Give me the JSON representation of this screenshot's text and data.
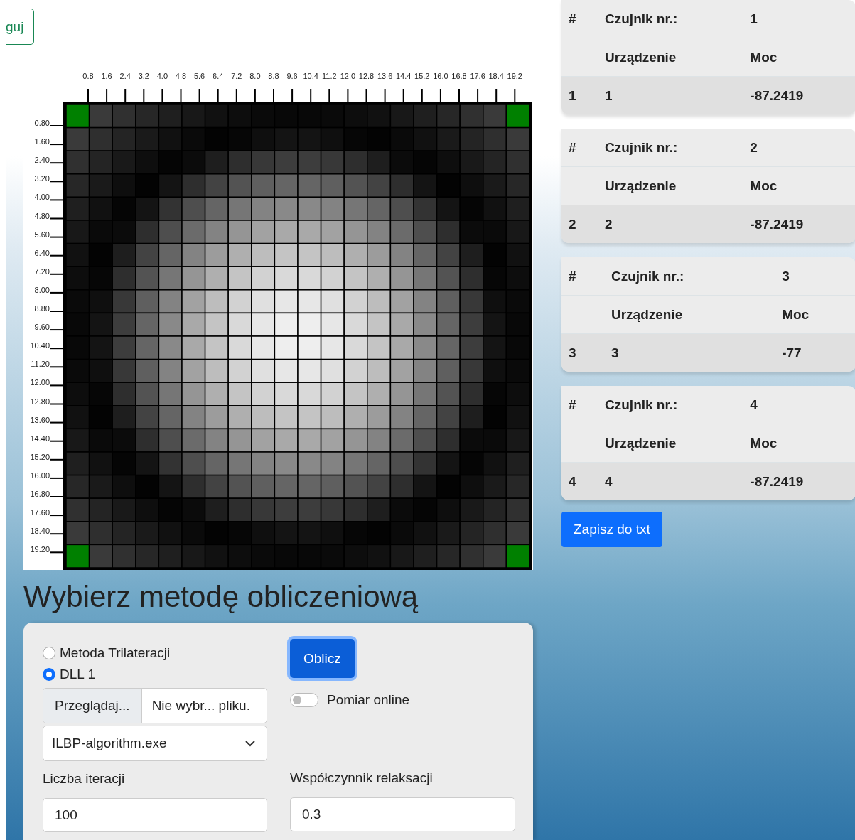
{
  "top_button": {
    "label": "guj"
  },
  "heatmap": {
    "x_ticks": [
      "0.8",
      "1.6",
      "2.4",
      "3.2",
      "4.0",
      "4.8",
      "5.6",
      "6.4",
      "7.2",
      "8.0",
      "8.8",
      "9.6",
      "10.4",
      "11.2",
      "12.0",
      "12.8",
      "13.6",
      "14.4",
      "15.2",
      "16.0",
      "16.8",
      "17.6",
      "18.4",
      "19.2"
    ],
    "y_ticks": [
      "0.80",
      "1.60",
      "2.40",
      "3.20",
      "4.00",
      "4.80",
      "5.60",
      "6.40",
      "7.20",
      "8.00",
      "8.80",
      "9.60",
      "10.40",
      "11.20",
      "12.00",
      "12.80",
      "13.60",
      "14.40",
      "15.20",
      "16.00",
      "16.80",
      "17.60",
      "18.40",
      "19.20"
    ]
  },
  "sensors": [
    {
      "hash": "#",
      "sensor_label": "Czujnik nr.:",
      "sensor_number": "1",
      "device_label": "Urządzenie",
      "power_label": "Moc",
      "index": "1",
      "device": "1",
      "power": "-87.2419"
    },
    {
      "hash": "#",
      "sensor_label": "Czujnik nr.:",
      "sensor_number": "2",
      "device_label": "Urządzenie",
      "power_label": "Moc",
      "index": "2",
      "device": "2",
      "power": "-87.2419"
    },
    {
      "hash": "#",
      "sensor_label": "Czujnik nr.:",
      "sensor_number": "3",
      "device_label": "Urządzenie",
      "power_label": "Moc",
      "index": "3",
      "device": "3",
      "power": "-77"
    },
    {
      "hash": "#",
      "sensor_label": "Czujnik nr.:",
      "sensor_number": "4",
      "device_label": "Urządzenie",
      "power_label": "Moc",
      "index": "4",
      "device": "4",
      "power": "-87.2419"
    }
  ],
  "save_button": {
    "label": "Zapisz do txt"
  },
  "method_title": "Wybierz metodę obliczeniową",
  "method_panel": {
    "methods": [
      {
        "label": "Metoda Trilateracji",
        "selected": false
      },
      {
        "label": "DLL 1",
        "selected": true
      }
    ],
    "browse_button": "Przeglądaj...",
    "file_name": "Nie wybr... pliku.",
    "select_value": "ILBP-algorithm.exe",
    "iterations": {
      "label": "Liczba iteracji",
      "value": "100"
    },
    "relaxation": {
      "label": "Współczynnik relaksacji",
      "value": "0.3"
    },
    "compute_button": "Oblicz",
    "online_switch": {
      "label": "Pomiar online",
      "on": false
    }
  }
}
